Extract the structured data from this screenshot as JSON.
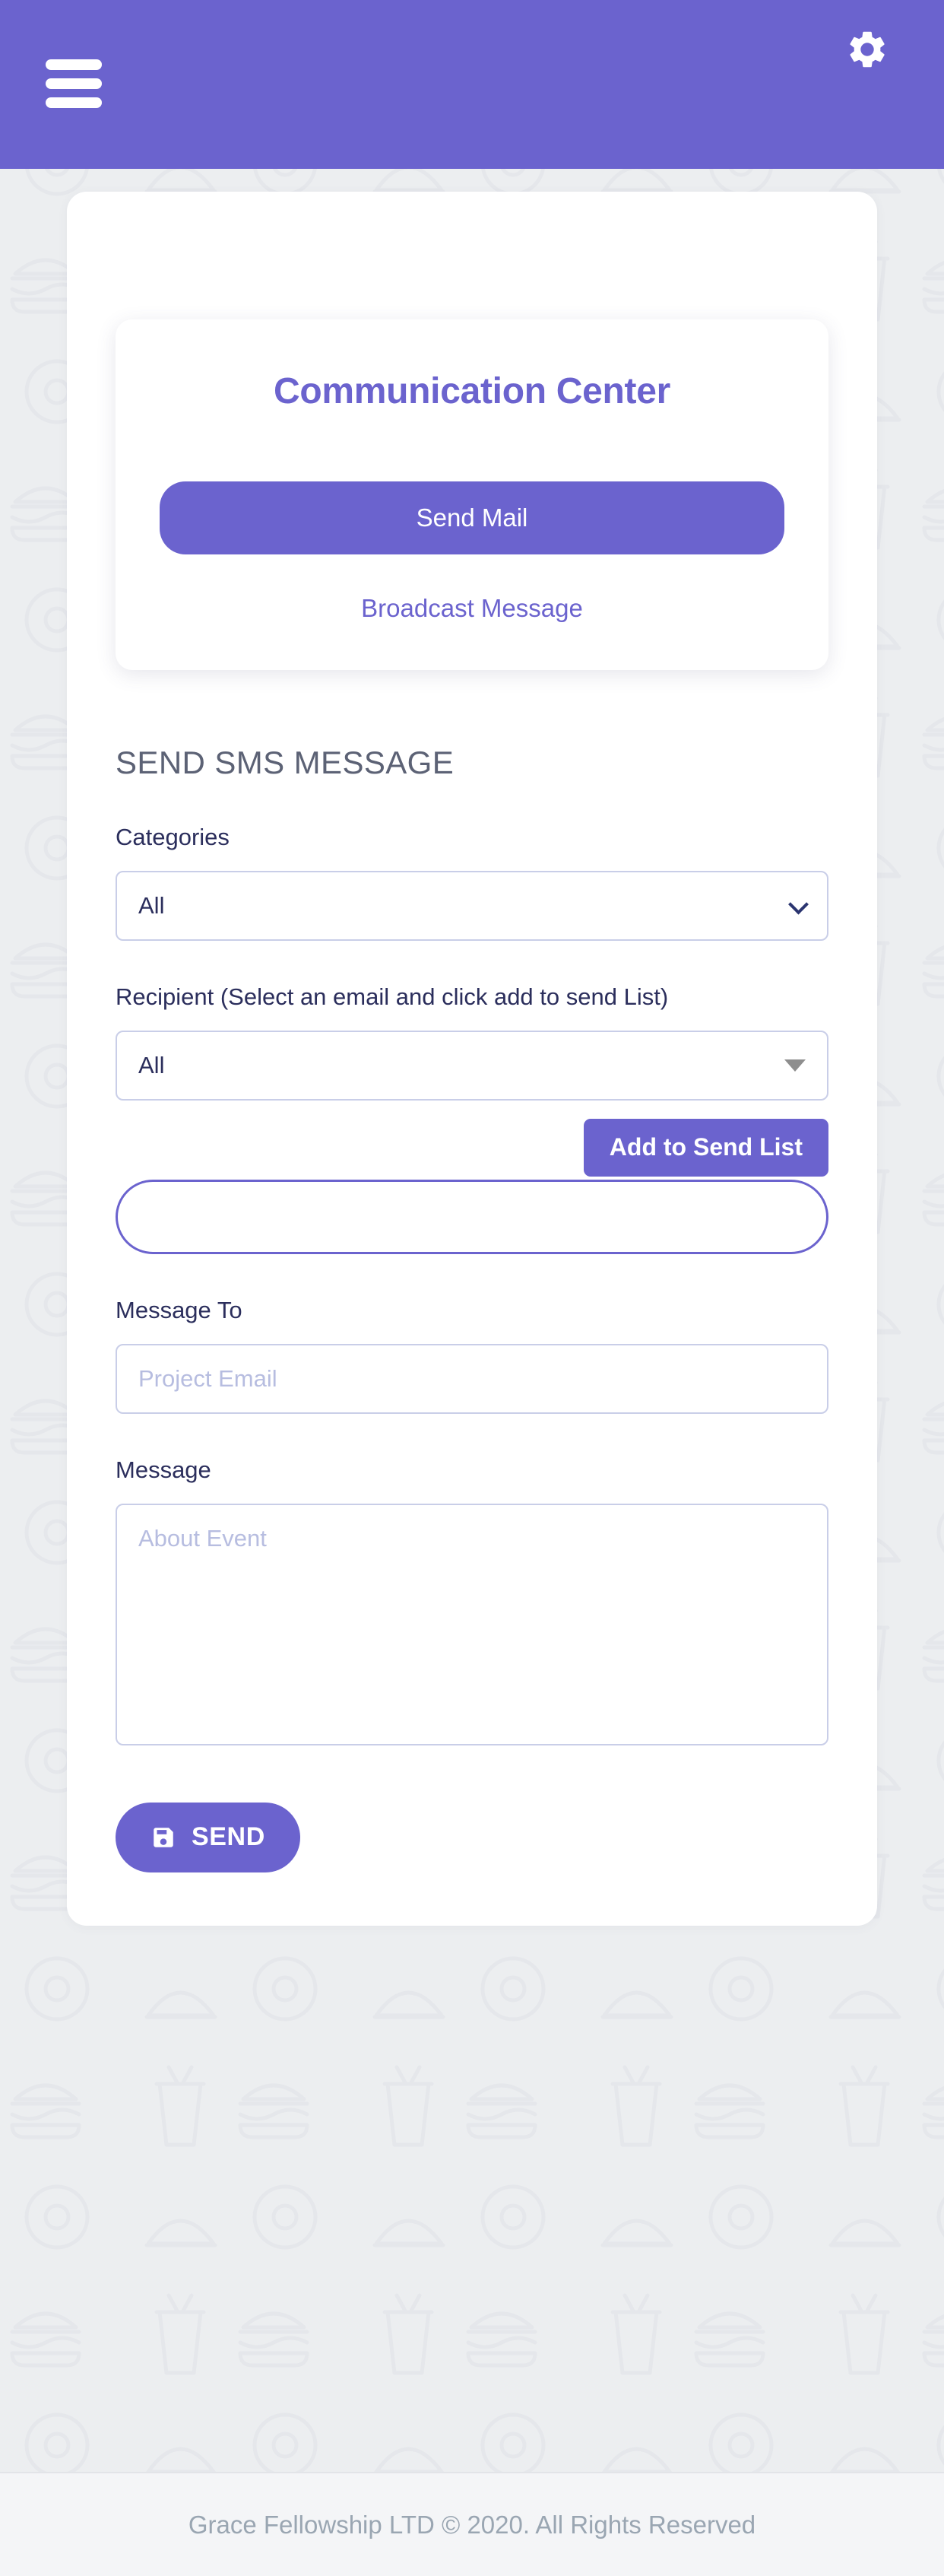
{
  "theme": {
    "primary": "#6b63ce",
    "page_bg": "#eceef0",
    "card_bg": "#ffffff",
    "label_color": "#2b2e5c",
    "placeholder_color": "#b7bde0",
    "heading_color": "#5c6275",
    "footer_color": "#9aa6b2"
  },
  "appbar": {
    "menu_icon": "hamburger-menu-icon",
    "settings_icon": "gear-icon"
  },
  "comm_card": {
    "title": "Communication Center",
    "send_mail_label": "Send Mail",
    "broadcast_label": "Broadcast Message"
  },
  "form": {
    "heading": "SEND SMS MESSAGE",
    "categories": {
      "label": "Categories",
      "value": "All",
      "options": [
        "All"
      ]
    },
    "recipient": {
      "label": "Recipient (Select an email and click add to send List)",
      "value": "All",
      "options": [
        "All"
      ],
      "add_button_label": "Add to Send List",
      "send_list_value": ""
    },
    "message_to": {
      "label": "Message To",
      "value": "",
      "placeholder": "Project Email"
    },
    "message": {
      "label": "Message",
      "value": "",
      "placeholder": "About Event"
    },
    "submit": {
      "label": "SEND",
      "icon": "save-floppy-icon"
    }
  },
  "footer": {
    "text": "Grace Fellowship LTD © 2020. All Rights Reserved"
  }
}
